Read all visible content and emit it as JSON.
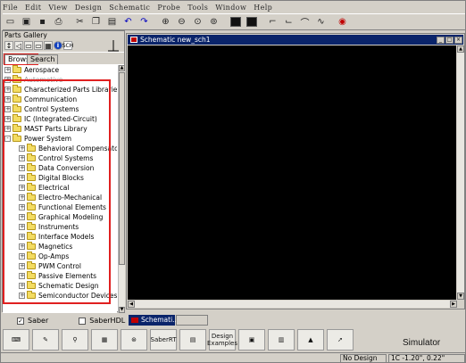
{
  "menu": [
    "File",
    "Edit",
    "View",
    "Design",
    "Schematic",
    "Probe",
    "Tools",
    "Window",
    "Help"
  ],
  "toolbar_icons": [
    "new-icon",
    "open-icon",
    "save-icon",
    "print-icon",
    "cut-icon",
    "copy-icon",
    "paste-icon",
    "undo-icon",
    "redo-icon",
    "zoom-in-icon",
    "zoom-out-icon",
    "zoom-fit-icon",
    "zoom-area-icon",
    "netlist-icon",
    "schematic-icon",
    "wire-icon",
    "bus-icon",
    "probe-icon",
    "waveform-icon",
    "simulate-icon"
  ],
  "gallery": {
    "title": "Parts Gallery",
    "tabs": [
      "Browse",
      "Search"
    ],
    "tree": [
      {
        "label": "Aerospace",
        "level": 0,
        "expander": "+",
        "muted": false
      },
      {
        "label": "Automotive",
        "level": 0,
        "expander": "+",
        "muted": true
      },
      {
        "label": "Characterized Parts Libraries",
        "level": 0,
        "expander": "+",
        "muted": false
      },
      {
        "label": "Communication",
        "level": 0,
        "expander": "+",
        "muted": false
      },
      {
        "label": "Control Systems",
        "level": 0,
        "expander": "+",
        "muted": false
      },
      {
        "label": "IC (Integrated-Circuit)",
        "level": 0,
        "expander": "+",
        "muted": false
      },
      {
        "label": "MAST Parts Library",
        "level": 0,
        "expander": "+",
        "muted": false
      },
      {
        "label": "Power System",
        "level": 0,
        "expander": "-",
        "muted": false
      },
      {
        "label": "Behavioral Compensators",
        "level": 1,
        "expander": "+",
        "muted": false
      },
      {
        "label": "Control Systems",
        "level": 1,
        "expander": "+",
        "muted": false
      },
      {
        "label": "Data Conversion",
        "level": 1,
        "expander": "+",
        "muted": false
      },
      {
        "label": "Digital Blocks",
        "level": 1,
        "expander": "+",
        "muted": false
      },
      {
        "label": "Electrical",
        "level": 1,
        "expander": "+",
        "muted": false
      },
      {
        "label": "Electro-Mechanical",
        "level": 1,
        "expander": "+",
        "muted": false
      },
      {
        "label": "Functional Elements",
        "level": 1,
        "expander": "+",
        "muted": false
      },
      {
        "label": "Graphical Modeling",
        "level": 1,
        "expander": "+",
        "muted": false
      },
      {
        "label": "Instruments",
        "level": 1,
        "expander": "+",
        "muted": false
      },
      {
        "label": "Interface Models",
        "level": 1,
        "expander": "+",
        "muted": false
      },
      {
        "label": "Magnetics",
        "level": 1,
        "expander": "+",
        "muted": false
      },
      {
        "label": "Op-Amps",
        "level": 1,
        "expander": "+",
        "muted": false
      },
      {
        "label": "PWM Control",
        "level": 1,
        "expander": "+",
        "muted": false
      },
      {
        "label": "Passive Elements",
        "level": 1,
        "expander": "+",
        "muted": false
      },
      {
        "label": "Schematic Design",
        "level": 1,
        "expander": "+",
        "muted": false
      },
      {
        "label": "Semiconductor Devices",
        "level": 1,
        "expander": "+",
        "muted": false
      }
    ],
    "checkboxes": [
      {
        "label": "Saber",
        "checked": true
      },
      {
        "label": "SaberHDL",
        "checked": false
      }
    ]
  },
  "schematic": {
    "title": "Schematic new_sch1",
    "minimized_title": "Schemati..."
  },
  "bottom_tools": [
    {
      "icon": "keyboard-icon",
      "label": ""
    },
    {
      "icon": "pen-icon",
      "label": ""
    },
    {
      "icon": "probe-tool-icon",
      "label": ""
    },
    {
      "icon": "scope-icon",
      "label": ""
    },
    {
      "icon": "reel-icon",
      "label": ""
    },
    {
      "icon": "saber-rt-icon",
      "label": "SaberRT"
    },
    {
      "icon": "model-icon",
      "label": ""
    },
    {
      "icon": "design-examples-icon",
      "label": "Design Examples"
    },
    {
      "icon": "document-icon",
      "label": ""
    },
    {
      "icon": "table-icon",
      "label": ""
    },
    {
      "icon": "matlab-icon",
      "label": ""
    },
    {
      "icon": "arrow-icon",
      "label": ""
    }
  ],
  "status": {
    "design": "No Design",
    "coords": "1C  -1.20\", 0.22\"",
    "brand": "Simulator"
  },
  "colors": {
    "title_active": "#0a246a",
    "canvas": "#000000",
    "highlight_red": "#e02020"
  }
}
